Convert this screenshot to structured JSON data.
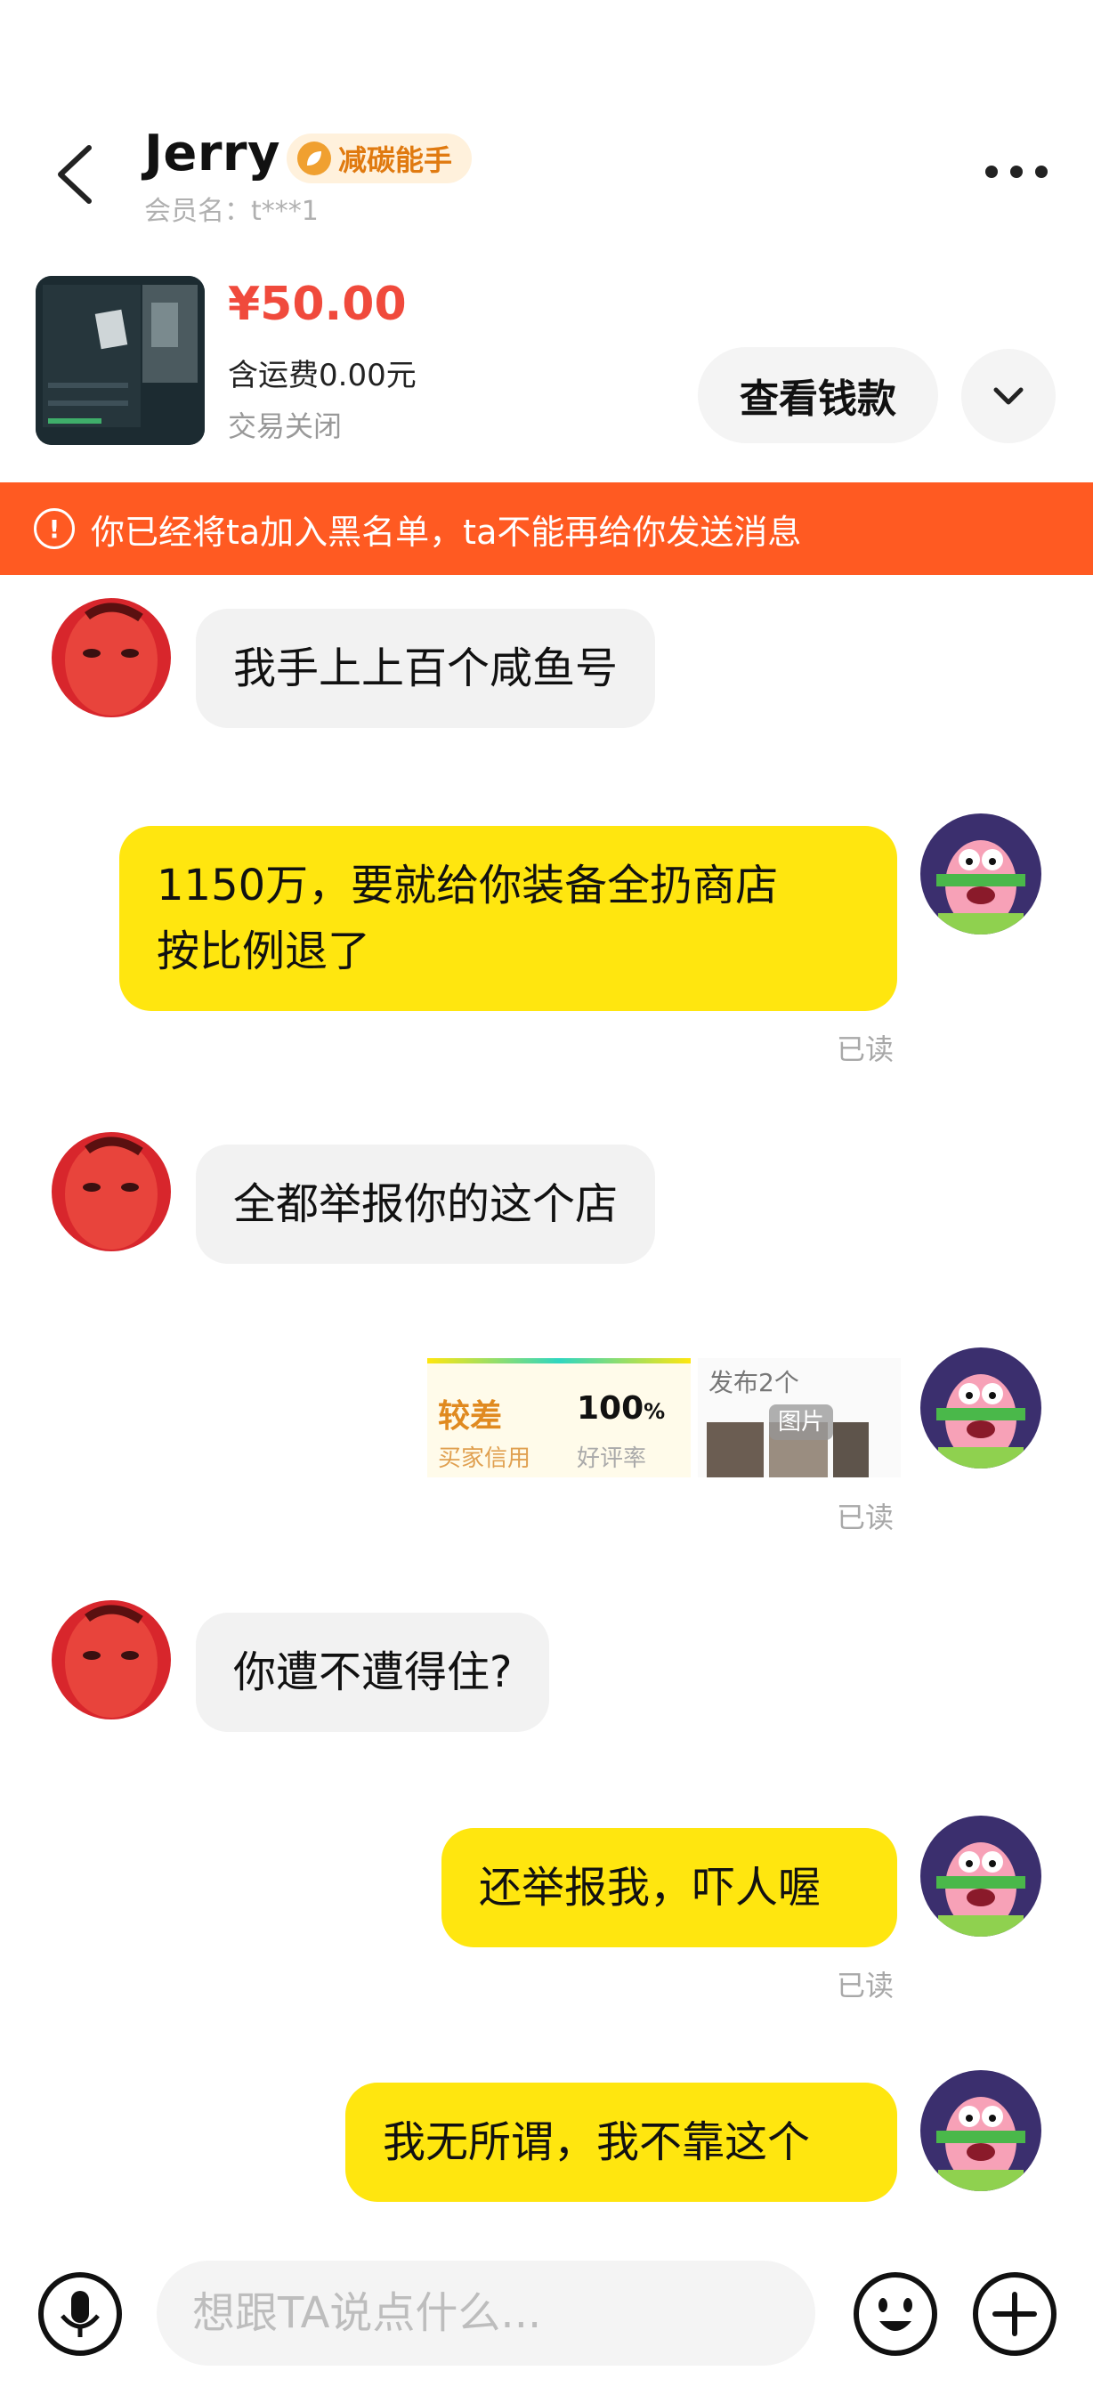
{
  "header": {
    "seller_name": "Jerry",
    "badge_label": "减碳能手",
    "member_label": "会员名：t***1"
  },
  "order": {
    "price": "¥50.00",
    "shipping": "含运费0.00元",
    "status": "交易关闭",
    "view_payment_label": "查看钱款"
  },
  "banner": {
    "text": "你已经将ta加入黑名单，ta不能再给你发送消息"
  },
  "messages": [
    {
      "side": "in",
      "text": "我手上上百个咸鱼号"
    },
    {
      "side": "out",
      "lines": [
        "1150万，要就给你装备全扔商店",
        "按比例退了"
      ],
      "read": "已读"
    },
    {
      "side": "in",
      "text": "全都举报你的这个店"
    },
    {
      "side": "out",
      "type": "shop-card",
      "read": "已读"
    },
    {
      "side": "in",
      "text": "你遭不遭得住?"
    },
    {
      "side": "out",
      "text": "还举报我，吓人喔",
      "read": "已读"
    },
    {
      "side": "out",
      "text": "我无所谓，我不靠这个"
    }
  ],
  "shop_card": {
    "credit_value": "较差",
    "credit_label": "买家信用",
    "rate_value": "100",
    "rate_unit": "%",
    "rate_label": "好评率",
    "posted": "发布2个",
    "image_tag": "图片"
  },
  "input_bar": {
    "placeholder": "想跟TA说点什么..."
  },
  "colors": {
    "accent_yellow": "#ffe60f",
    "banner_orange": "#ff5a22",
    "price_red": "#f04a3c",
    "badge_orange": "#e07a10"
  },
  "icons": [
    "back-icon",
    "leaf-icon",
    "more-icon",
    "chevron-down-icon",
    "warning-icon",
    "mic-icon",
    "emoji-icon",
    "plus-icon"
  ]
}
